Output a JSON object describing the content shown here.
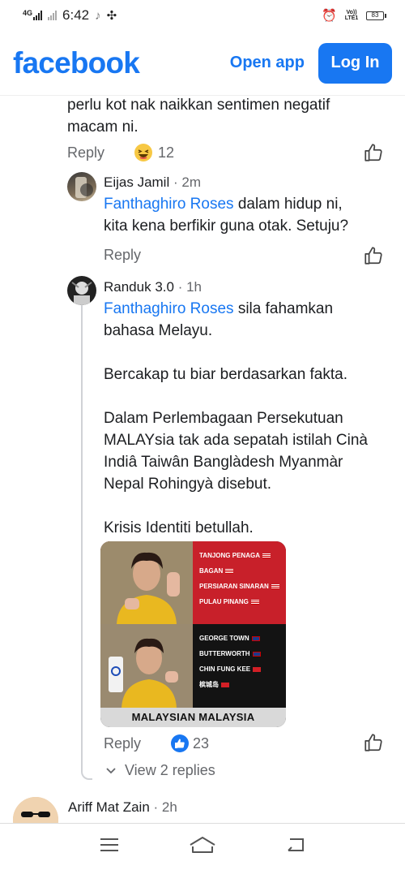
{
  "status_bar": {
    "network": "4G",
    "time": "6:42",
    "volte": "Vo)) LTE1",
    "battery": "83"
  },
  "header": {
    "logo": "facebook",
    "open_app": "Open app",
    "login": "Log In"
  },
  "previous_comment": {
    "text_line1": "perlu kot nak naikkan sentimen negatif",
    "text_line2": "macam ni.",
    "reply": "Reply",
    "reaction_count": "12"
  },
  "comments": [
    {
      "author": "Eijas Jamil",
      "time": "· 2m",
      "mention": "Fanthaghiro Roses",
      "text_line1": " dalam hidup ni,",
      "text_line2": "kita kena berfikir guna otak. Setuju?",
      "reply": "Reply"
    },
    {
      "author": "Randuk 3.0",
      "time": "· 1h",
      "mention": "Fanthaghiro Roses",
      "text_line1": " sila fahamkan",
      "text_line2": "bahasa Melayu.",
      "para2": "Bercakap tu biar berdasarkan fakta.",
      "para3_line1": "Dalam Perlembagaan Persekutuan",
      "para3_line2": "MALAYsia tak ada sepatah istilah Cinà",
      "para3_line3": "Indiâ Taiwân Banglàdesh Myanmàr",
      "para3_line4": "Nepal Rohingyà disebut.",
      "para4": "Krisis Identiti betullah.",
      "reply": "Reply",
      "reaction_count": "23",
      "view_replies": "View 2 replies",
      "image": {
        "top_lines": [
          "TANJONG PENAGA",
          "BAGAN",
          "PERSIARAN SINARAN",
          "PULAU PINANG"
        ],
        "bottom_lines": [
          "GEORGE TOWN",
          "BUTTERWORTH",
          "CHIN FUNG KEE",
          "槟城岛"
        ],
        "caption": "MALAYSIAN MALAYSIA"
      }
    },
    {
      "author": "Ariff Mat Zain",
      "time": "· 2h"
    }
  ],
  "colors": {
    "facebook_blue": "#1877f2",
    "muted_text": "#65676b",
    "image_red": "#c8202a"
  }
}
